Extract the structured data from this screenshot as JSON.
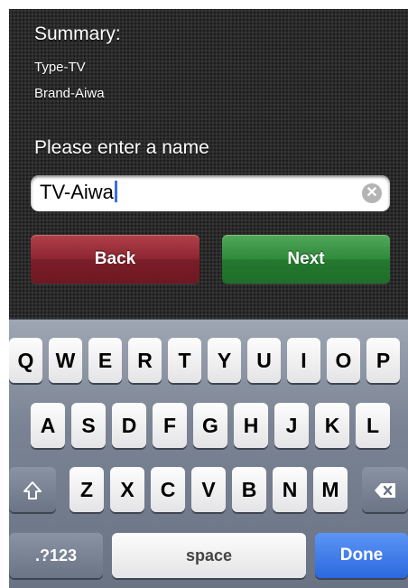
{
  "summary": {
    "title": "Summary:",
    "type_line": "Type-TV",
    "brand_line": "Brand-Aiwa"
  },
  "prompt": "Please enter a name",
  "name_input": {
    "value": "TV-Aiwa"
  },
  "buttons": {
    "back": "Back",
    "next": "Next"
  },
  "keyboard": {
    "row1": [
      "Q",
      "W",
      "E",
      "R",
      "T",
      "Y",
      "U",
      "I",
      "O",
      "P"
    ],
    "row2": [
      "A",
      "S",
      "D",
      "F",
      "G",
      "H",
      "J",
      "K",
      "L"
    ],
    "row3": [
      "Z",
      "X",
      "C",
      "V",
      "B",
      "N",
      "M"
    ],
    "numbers_key": ".?123",
    "space_key": "space",
    "done_key": "Done"
  },
  "colors": {
    "back_button": "#8c2531",
    "next_button": "#2f8a3c",
    "done_key": "#2a69de",
    "cursor": "#3b6fe0"
  },
  "icons": {
    "clear": "clear-icon",
    "shift": "shift-icon",
    "backspace": "backspace-icon"
  }
}
